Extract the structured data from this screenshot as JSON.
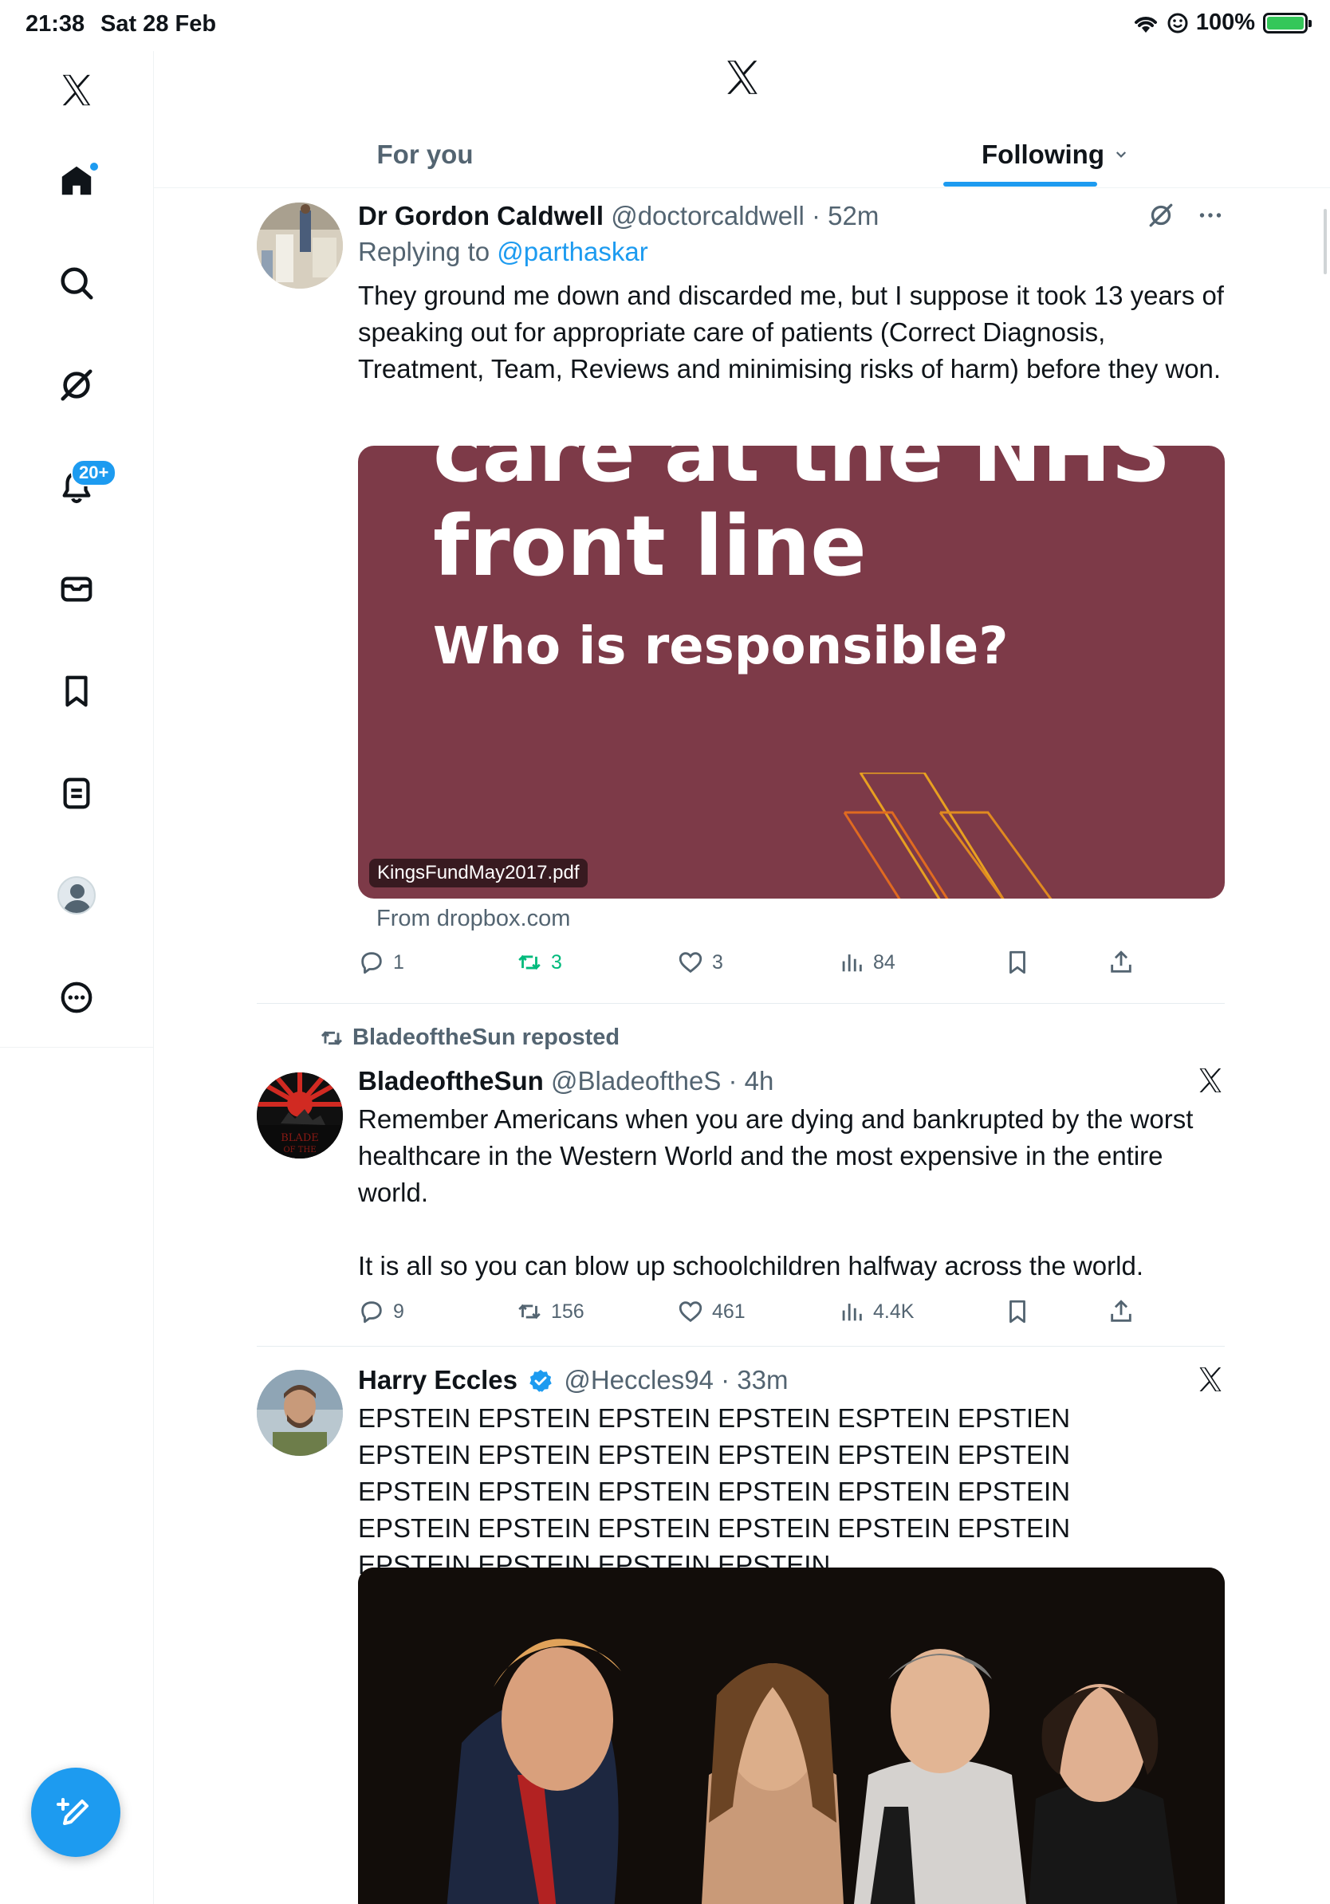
{
  "status_bar": {
    "time": "21:38",
    "date": "Sat 28 Feb",
    "battery": "100%"
  },
  "sidebar": {
    "notifications_badge": "20+"
  },
  "tabs": {
    "for_you": "For you",
    "following": "Following"
  },
  "tweets": [
    {
      "name": "Dr Gordon Caldwell",
      "handle": "@doctorcaldwell",
      "time": "52m",
      "replying_prefix": "Replying to",
      "replying_to": "@parthaskar",
      "text": "They ground me down and discarded me, but I suppose it took 13 years of speaking out for appropriate care of patients (Correct Diagnosis, Treatment, Team, Reviews and minimising risks of harm) before they won.",
      "media": {
        "line_partial": "care at the NHS",
        "line_main": "front line",
        "line_sub": "Who is responsible?",
        "filename": "KingsFundMay2017.pdf",
        "source": "From dropbox.com"
      },
      "stats": {
        "replies": "1",
        "reposts": "3",
        "likes": "3",
        "views": "84"
      }
    },
    {
      "repost_label": "BladeoftheSun reposted",
      "name": "BladeoftheSun",
      "handle": "@BladeoftheS",
      "time": "4h",
      "paragraphs": [
        "Remember Americans when you are dying and bankrupted by the worst healthcare in the Western World and the most expensive in the entire world.",
        "It is all so you can blow up schoolchildren halfway across the world."
      ],
      "stats": {
        "replies": "9",
        "reposts": "156",
        "likes": "461",
        "views": "4.4K"
      }
    },
    {
      "name": "Harry Eccles",
      "handle": "@Heccles94",
      "time": "33m",
      "text": "EPSTEIN EPSTEIN EPSTEIN EPSTEIN ESPTEIN EPSTIEN EPSTEIN EPSTEIN EPSTEIN EPSTEIN EPSTEIN EPSTEIN EPSTEIN EPSTEIN EPSTEIN EPSTEIN EPSTEIN EPSTEIN EPSTEIN EPSTEIN EPSTEIN EPSTEIN EPSTEIN EPSTEIN EPSTEIN EPSTEIN EPSTEIN EPSTEIN"
    }
  ],
  "colors": {
    "accent": "#1d9bf0",
    "repost_green": "#00ba7c",
    "nhs_card": "#7d3a48"
  },
  "icons": [
    "x-logo-icon",
    "home-icon",
    "search-icon",
    "grok-icon",
    "bell-icon",
    "mail-icon",
    "bookmark-icon",
    "lists-icon",
    "profile-icon",
    "more-icon",
    "compose-icon",
    "reply-icon",
    "repost-icon",
    "like-icon",
    "views-icon",
    "share-icon"
  ]
}
